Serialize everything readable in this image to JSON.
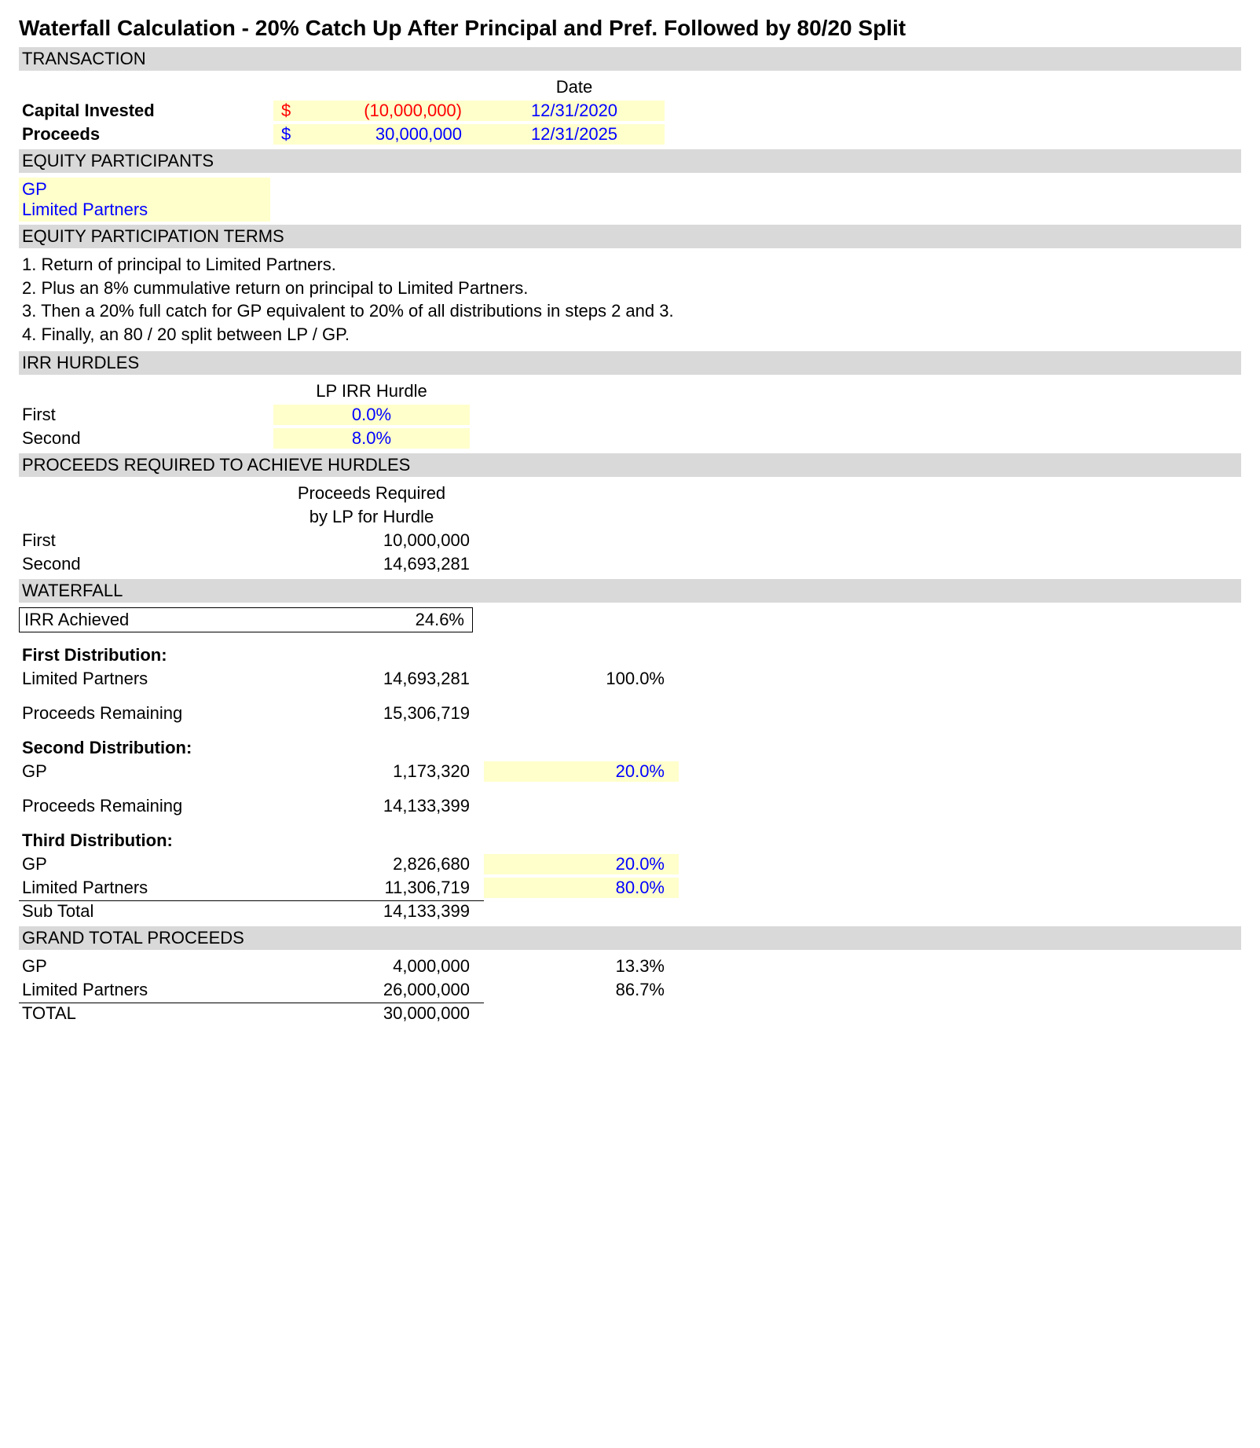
{
  "title": "Waterfall Calculation - 20% Catch Up After Principal and Pref. Followed by 80/20 Split",
  "sections": {
    "transaction": "TRANSACTION",
    "participants": "EQUITY PARTICIPANTS",
    "terms": "EQUITY PARTICIPATION TERMS",
    "hurdles": "IRR HURDLES",
    "proceeds_req": "PROCEEDS REQUIRED TO ACHIEVE HURDLES",
    "waterfall": "WATERFALL",
    "grand_total": "GRAND TOTAL PROCEEDS"
  },
  "transaction": {
    "date_header": "Date",
    "capital_label": "Capital Invested",
    "capital_sym": "$",
    "capital_amount": "(10,000,000)",
    "capital_date": "12/31/2020",
    "proceeds_label": "Proceeds",
    "proceeds_sym": "$",
    "proceeds_amount": "30,000,000",
    "proceeds_date": "12/31/2025"
  },
  "participants": {
    "gp": "GP",
    "lp": "Limited Partners"
  },
  "terms": {
    "l1": "1. Return of principal to Limited Partners.",
    "l2": "2. Plus an 8% cummulative return on principal to Limited Partners.",
    "l3": "3. Then a 20% full catch for GP equivalent to 20% of all distributions in steps 2 and 3.",
    "l4": "4. Finally, an 80 / 20 split between LP / GP."
  },
  "hurdles": {
    "header": "LP IRR Hurdle",
    "first_label": "First",
    "first_val": "0.0%",
    "second_label": "Second",
    "second_val": "8.0%"
  },
  "proceeds_req": {
    "header1": "Proceeds Required",
    "header2": "by LP for Hurdle",
    "first_label": "First",
    "first_val": "10,000,000",
    "second_label": "Second",
    "second_val": "14,693,281"
  },
  "waterfall": {
    "irr_label": "IRR Achieved",
    "irr_val": "24.6%",
    "dist1_title": "First Distribution:",
    "dist1_lp_label": "Limited Partners",
    "dist1_lp_amount": "14,693,281",
    "dist1_lp_pct": "100.0%",
    "remain1_label": "Proceeds Remaining",
    "remain1_val": "15,306,719",
    "dist2_title": "Second Distribution:",
    "dist2_gp_label": "GP",
    "dist2_gp_amount": "1,173,320",
    "dist2_gp_pct": "20.0%",
    "remain2_label": "Proceeds Remaining",
    "remain2_val": "14,133,399",
    "dist3_title": "Third Distribution:",
    "dist3_gp_label": "GP",
    "dist3_gp_amount": "2,826,680",
    "dist3_gp_pct": "20.0%",
    "dist3_lp_label": "Limited Partners",
    "dist3_lp_amount": "11,306,719",
    "dist3_lp_pct": "80.0%",
    "subtotal_label": "Sub Total",
    "subtotal_val": "14,133,399"
  },
  "grand_total": {
    "gp_label": "GP",
    "gp_amount": "4,000,000",
    "gp_pct": "13.3%",
    "lp_label": "Limited Partners",
    "lp_amount": "26,000,000",
    "lp_pct": "86.7%",
    "total_label": "TOTAL",
    "total_amount": "30,000,000"
  }
}
